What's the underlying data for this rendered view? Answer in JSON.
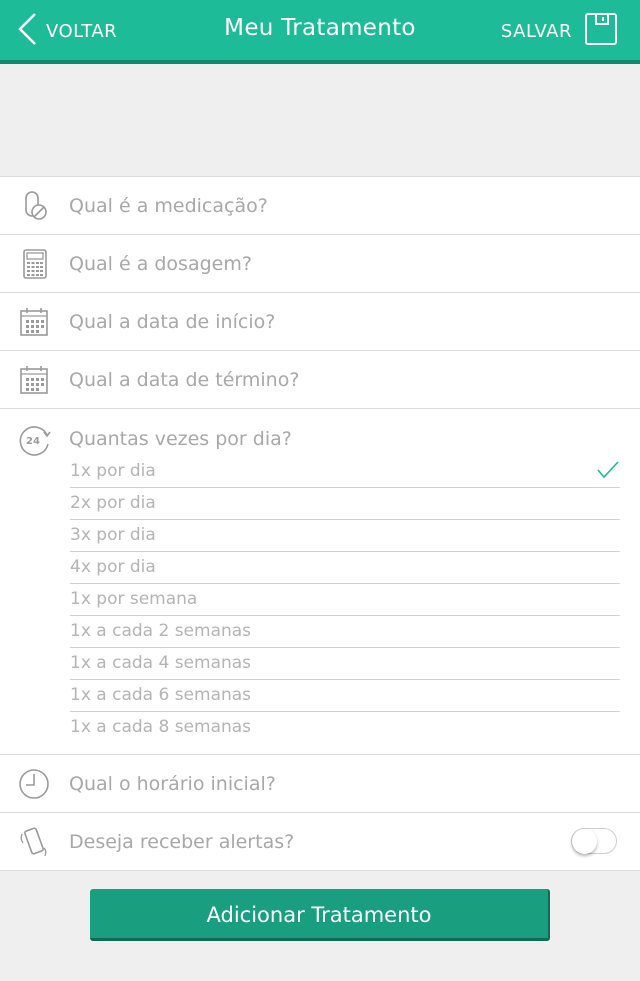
{
  "colors": {
    "header_bg": "#1dbb98",
    "header_border": "#138a70",
    "button_bg": "#1a9e80",
    "checkmark": "#1dbb98"
  },
  "header": {
    "back_label": "VOLTAR",
    "title": "Meu Tratamento",
    "save_label": "SALVAR",
    "icons": {
      "back": "chevron-left-icon",
      "save": "save-icon"
    }
  },
  "form": {
    "medication": {
      "icon": "pill-icon",
      "placeholder": "Qual é a medicação?"
    },
    "dosage": {
      "icon": "calculator-icon",
      "placeholder": "Qual é a dosagem?"
    },
    "start_date": {
      "icon": "calendar-icon",
      "placeholder": "Qual a data de início?"
    },
    "end_date": {
      "icon": "calendar-icon",
      "placeholder": "Qual a data de término?"
    },
    "frequency": {
      "icon": "24h-repeat-icon",
      "label": "Quantas vezes por dia?",
      "options": [
        {
          "label": "1x por dia",
          "selected": true
        },
        {
          "label": "2x por dia",
          "selected": false
        },
        {
          "label": "3x por dia",
          "selected": false
        },
        {
          "label": "4x por dia",
          "selected": false
        },
        {
          "label": "1x por semana",
          "selected": false
        },
        {
          "label": "1x a cada 2 semanas",
          "selected": false
        },
        {
          "label": "1x a cada 4 semanas",
          "selected": false
        },
        {
          "label": "1x a cada 6 semanas",
          "selected": false
        },
        {
          "label": "1x a cada 8 semanas",
          "selected": false
        }
      ]
    },
    "start_time": {
      "icon": "clock-icon",
      "placeholder": "Qual o horário inicial?"
    },
    "alerts": {
      "icon": "vibrating-phone-icon",
      "label": "Deseja receber alertas?",
      "enabled": false
    }
  },
  "add_button": {
    "label": "Adicionar Tratamento"
  }
}
